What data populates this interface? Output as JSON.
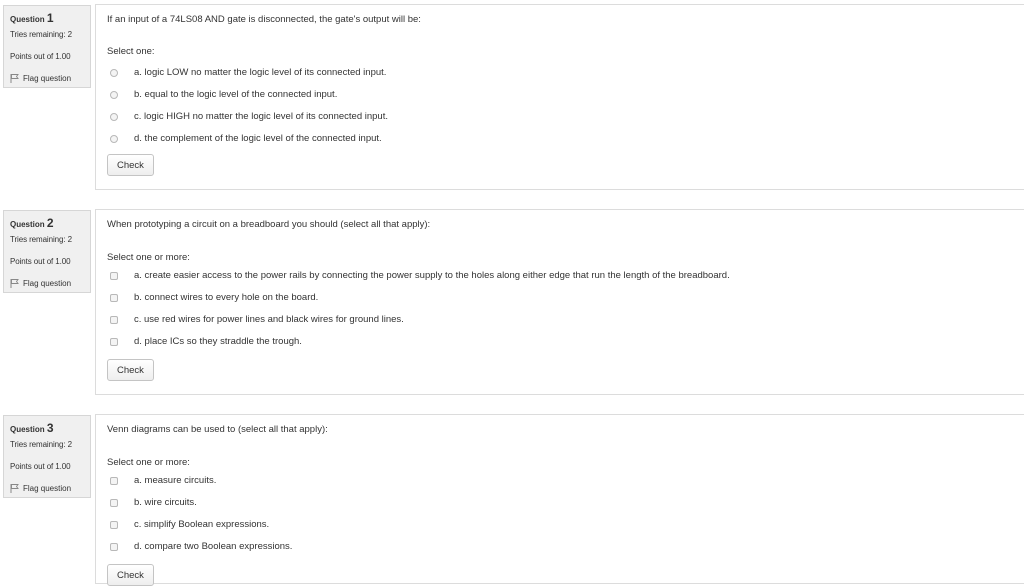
{
  "questions": [
    {
      "label": "Question",
      "number": "1",
      "tries": "Tries remaining: 2",
      "points": "Points out of 1.00",
      "flag": "Flag question",
      "text": "If an input of a 74LS08 AND gate is disconnected, the gate's output will be:",
      "prompt": "Select one:",
      "input_type": "radio",
      "answers": [
        "a. logic LOW no matter the logic level of its connected input.",
        "b. equal to the logic level of the connected input.",
        "c. logic HIGH no matter the logic level of its connected input.",
        "d. the complement of the logic level of the connected input."
      ],
      "check": "Check"
    },
    {
      "label": "Question",
      "number": "2",
      "tries": "Tries remaining: 2",
      "points": "Points out of 1.00",
      "flag": "Flag question",
      "text": "When prototyping a circuit on a breadboard you should (select all that apply):",
      "prompt": "Select one or more:",
      "input_type": "checkbox",
      "answers": [
        "a. create easier access to the power rails by connecting the power supply to the holes along either edge that run the length of the breadboard.",
        "b. connect wires to every hole on the board.",
        "c. use red wires for power lines and black wires for ground lines.",
        "d. place ICs so they straddle the trough."
      ],
      "check": "Check"
    },
    {
      "label": "Question",
      "number": "3",
      "tries": "Tries remaining: 2",
      "points": "Points out of 1.00",
      "flag": "Flag question",
      "text": "Venn diagrams can be used to (select all that apply):",
      "prompt": "Select one or more:",
      "input_type": "checkbox",
      "answers": [
        "a. measure circuits.",
        "b. wire circuits.",
        "c. simplify Boolean expressions.",
        "d. compare two Boolean expressions."
      ],
      "check": "Check"
    }
  ]
}
